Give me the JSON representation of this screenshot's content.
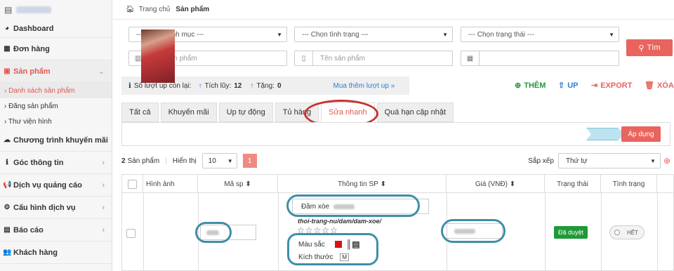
{
  "sidebar": {
    "items": [
      {
        "label": "Dashboard",
        "icon": "dashboard-icon",
        "glyph": "◕"
      },
      {
        "label": "Đơn hàng",
        "icon": "table-icon",
        "glyph": "▦"
      },
      {
        "label": "Sản phẩm",
        "icon": "gift-icon",
        "glyph": "▣"
      },
      {
        "label": "Chương trình khuyến mãi",
        "icon": "cloud-icon",
        "glyph": "☁"
      },
      {
        "label": "Góc thông tin",
        "icon": "info-icon",
        "glyph": "ℹ"
      },
      {
        "label": "Dịch vụ quảng cáo",
        "icon": "megaphone-icon",
        "glyph": "📢"
      },
      {
        "label": "Cấu hình dịch vụ",
        "icon": "gear-icon",
        "glyph": "⚙"
      },
      {
        "label": "Báo cáo",
        "icon": "report-icon",
        "glyph": "▤"
      },
      {
        "label": "Khách hàng",
        "icon": "users-icon",
        "glyph": "👥"
      }
    ],
    "sub": [
      {
        "label": "› Danh sách sản phẩm"
      },
      {
        "label": "› Đăng sản phẩm"
      },
      {
        "label": "› Thư viện hình"
      }
    ]
  },
  "breadcrumb": {
    "home": "Trang chủ",
    "current": "Sản phẩm"
  },
  "filters": {
    "category": "--- Chọn danh mục ---",
    "condition": "--- Chọn tình trạng ---",
    "status": "--- Chọn trạng thái ---",
    "sku_placeholder": "Mã sản phẩm",
    "name_placeholder": "Tên sản phẩm",
    "search_label": "Tìm"
  },
  "stats": {
    "remaining_label": "Số lượt up còn lại:",
    "accum_label": "Tích lũy:",
    "accum_value": "12",
    "gift_label": "Tặng:",
    "gift_value": "0",
    "buy_link": "Mua thêm lượt up »"
  },
  "actions": {
    "add": "THÊM",
    "up": "UP",
    "export": "EXPORT",
    "delete": "XÓA"
  },
  "tabs": [
    "Tất cả",
    "Khuyến mãi",
    "Up tự động",
    "Tủ hàng",
    "Sửa nhanh",
    "Quá hạn cập nhật"
  ],
  "apply_label": "Áp dụng",
  "list": {
    "count": "2",
    "count_label": "Sản phẩm",
    "show_label": "Hiển thị",
    "page_size": "10",
    "page": "1",
    "sort_label": "Sắp xếp",
    "sort_value": "Thứ tự"
  },
  "columns": [
    "Hình ảnh",
    "Mã sp",
    "Thông tin SP",
    "Giá (VNĐ)",
    "Trạng thái",
    "Tình trạng"
  ],
  "row": {
    "name_prefix": "Đầm xòe",
    "url": "thoi-trang-nu/dam/dam-xoe/",
    "color_label": "Màu sắc",
    "size_label": "Kích thước",
    "size_value": "M",
    "status": "Đã duyệt",
    "stock": "HẾT"
  },
  "colors": {
    "accent": "#e9645d",
    "link": "#2a7fd4",
    "ok": "#1e9a38",
    "ring": "#3f8fa8"
  }
}
